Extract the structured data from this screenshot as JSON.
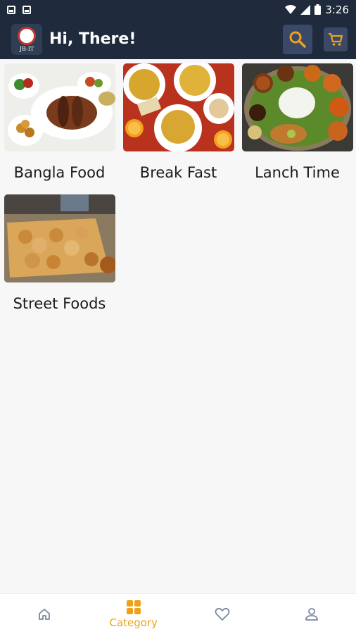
{
  "status_bar": {
    "time": "3:26"
  },
  "app_bar": {
    "title": "Hi, There!",
    "logo_text": "JB-IT"
  },
  "categories": [
    {
      "label": "Bangla Food"
    },
    {
      "label": "Break Fast"
    },
    {
      "label": "Lanch Time"
    },
    {
      "label": "Street Foods"
    }
  ],
  "bottom_nav": {
    "items": [
      {
        "icon": "home-icon",
        "label": ""
      },
      {
        "icon": "category-icon",
        "label": "Category",
        "active": true
      },
      {
        "icon": "heart-icon",
        "label": ""
      },
      {
        "icon": "profile-icon",
        "label": ""
      }
    ]
  },
  "colors": {
    "app_bar": "#1f2a3c",
    "accent": "#f0a11a",
    "inactive": "#7a86a1"
  }
}
